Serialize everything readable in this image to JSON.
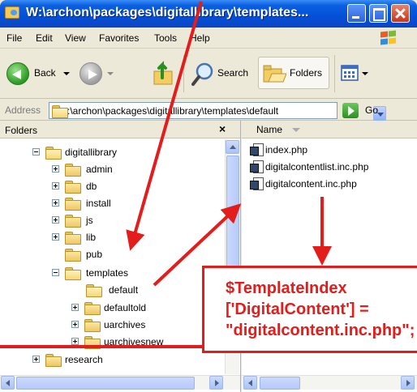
{
  "window": {
    "title": "W:\\archon\\packages\\digitallibrary\\templates..."
  },
  "menu": {
    "items": [
      "File",
      "Edit",
      "View",
      "Favorites",
      "Tools",
      "Help"
    ]
  },
  "toolbar": {
    "back_label": "Back",
    "search_label": "Search",
    "folders_label": "Folders"
  },
  "address": {
    "label": "Address",
    "value": ":\\archon\\packages\\digitallibrary\\templates\\default",
    "go_label": "Go"
  },
  "folders_pane": {
    "title": "Folders",
    "close_glyph": "×",
    "tree": [
      {
        "label": "digitallibrary",
        "expander": "minus"
      },
      {
        "label": "admin",
        "expander": "plus"
      },
      {
        "label": "db",
        "expander": "plus"
      },
      {
        "label": "install",
        "expander": "plus"
      },
      {
        "label": "js",
        "expander": "plus"
      },
      {
        "label": "lib",
        "expander": "plus"
      },
      {
        "label": "pub",
        "expander": "none"
      },
      {
        "label": "templates",
        "expander": "minus"
      },
      {
        "label": "default",
        "expander": "none"
      },
      {
        "label": "defaultold",
        "expander": "plus"
      },
      {
        "label": "uarchives",
        "expander": "plus"
      },
      {
        "label": "uarchivesnew",
        "expander": "plus"
      },
      {
        "label": "research",
        "expander": "plus"
      }
    ]
  },
  "files_pane": {
    "column_name": "Name",
    "files": [
      "index.php",
      "digitalcontentlist.inc.php",
      "digitalcontent.inc.php"
    ]
  },
  "annotation": {
    "line1": "$TemplateIndex",
    "line2": "['DigitalContent'] =",
    "line3": "\"digitalcontent.inc.php\";",
    "color": "#e31c1c"
  },
  "icons": [
    "window-folder-icon",
    "minimize-icon",
    "maximize-icon",
    "close-icon",
    "windows-logo-icon",
    "back-arrow-icon",
    "forward-arrow-icon",
    "up-folder-icon",
    "search-magnifier-icon",
    "folders-icon",
    "views-icon",
    "folder-icon",
    "go-arrow-icon",
    "php-file-icon"
  ]
}
